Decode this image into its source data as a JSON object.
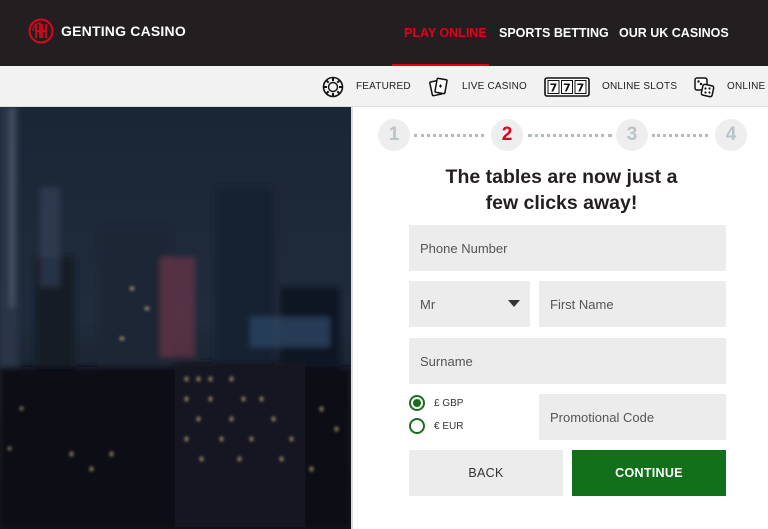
{
  "header": {
    "brand": "GENTING CASINO",
    "nav": [
      {
        "label": "PLAY ONLINE",
        "active": true
      },
      {
        "label": "SPORTS BETTING",
        "active": false
      },
      {
        "label": "OUR UK CASINOS",
        "active": false
      }
    ],
    "accent_color": "#e2001a"
  },
  "subnav": {
    "items": [
      {
        "label": "FEATURED",
        "icon": "poker-chip-icon"
      },
      {
        "label": "LIVE CASINO",
        "icon": "playing-cards-icon"
      },
      {
        "label": "ONLINE SLOTS",
        "icon": "slot-777-icon"
      },
      {
        "label": "ONLINE C",
        "icon": "dice-icon"
      }
    ]
  },
  "steps": {
    "items": [
      "1",
      "2",
      "3",
      "4"
    ],
    "current": 2
  },
  "form": {
    "heading_line1": "The tables are now just a",
    "heading_line2": "few clicks away!",
    "phone_placeholder": "Phone Number",
    "title_value": "Mr",
    "first_name_placeholder": "First Name",
    "surname_placeholder": "Surname",
    "currency_options": [
      {
        "label": "£ GBP",
        "selected": true
      },
      {
        "label": "€ EUR",
        "selected": false
      }
    ],
    "promo_placeholder": "Promotional Code",
    "back_label": "BACK",
    "continue_label": "CONTINUE",
    "continue_color": "#12701a"
  }
}
